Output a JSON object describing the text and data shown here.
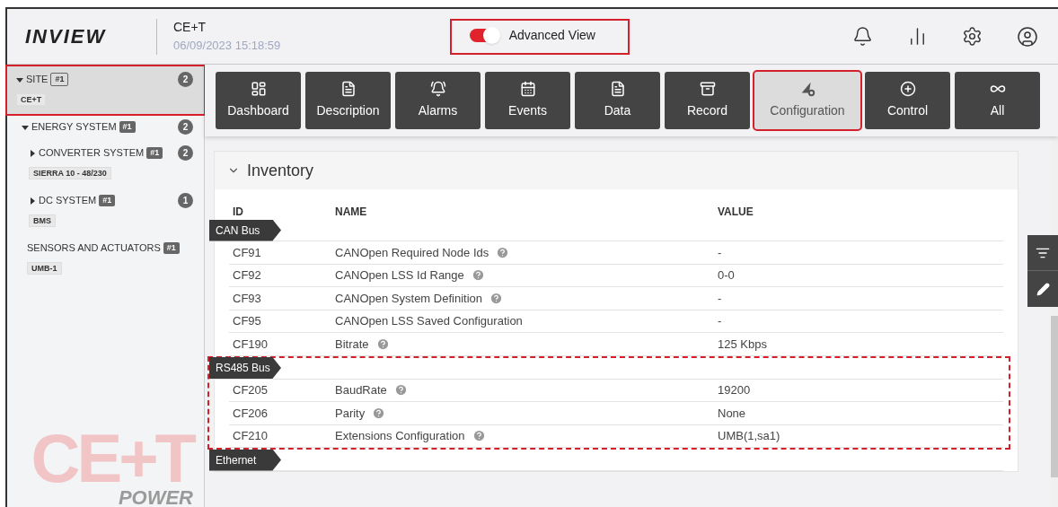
{
  "header": {
    "logo": "INVIEW",
    "site": "CE+T",
    "datetime": "06/09/2023 15:18:59",
    "advanced_view": {
      "label": "Advanced View",
      "on": true,
      "highlighted": true
    }
  },
  "sidebar": {
    "items": [
      {
        "label": "SITE",
        "tag": "#1",
        "sub": "CE+T",
        "count": "2",
        "expanded": true,
        "selected": true,
        "highlighted": true,
        "children": [
          {
            "label": "ENERGY SYSTEM",
            "tag": "#1",
            "count": "2",
            "expanded": true,
            "selected": false,
            "highlighted": false,
            "children": [
              {
                "label": "CONVERTER SYSTEM",
                "tag": "#1",
                "sub": "SIERRA 10 - 48/230",
                "count": "2",
                "expanded": false,
                "selected": false,
                "highlighted": false
              },
              {
                "label": "DC SYSTEM",
                "tag": "#1",
                "sub": "BMS",
                "count": "1",
                "expanded": false,
                "selected": false,
                "highlighted": false
              }
            ]
          },
          {
            "label": "SENSORS AND ACTUATORS",
            "tag": "#1",
            "sub": "UMB-1",
            "selected": false,
            "highlighted": false
          }
        ]
      }
    ],
    "logo": {
      "mark": "CE+T",
      "word": "POWER"
    }
  },
  "tabs": [
    {
      "label": "Dashboard",
      "selected": false,
      "highlighted": false
    },
    {
      "label": "Description",
      "selected": false,
      "highlighted": false
    },
    {
      "label": "Alarms",
      "selected": false,
      "highlighted": false
    },
    {
      "label": "Events",
      "selected": false,
      "highlighted": false
    },
    {
      "label": "Data",
      "selected": false,
      "highlighted": false
    },
    {
      "label": "Record",
      "selected": false,
      "highlighted": false
    },
    {
      "label": "Configuration",
      "selected": true,
      "highlighted": true
    },
    {
      "label": "Control",
      "selected": false,
      "highlighted": false
    },
    {
      "label": "All",
      "selected": false,
      "highlighted": false
    }
  ],
  "panel": {
    "title": "Inventory",
    "expanded": true,
    "columns": [
      "ID",
      "NAME",
      "VALUE"
    ],
    "groups": [
      {
        "label": "CAN Bus",
        "highlighted": false,
        "rows": [
          {
            "id": "CF91",
            "name": "CANOpen Required Node Ids",
            "help": true,
            "value": "-"
          },
          {
            "id": "CF92",
            "name": "CANOpen LSS Id Range",
            "help": true,
            "value": "0-0"
          },
          {
            "id": "CF93",
            "name": "CANOpen System Definition",
            "help": true,
            "value": "-"
          },
          {
            "id": "CF95",
            "name": "CANOpen LSS Saved Configuration",
            "help": false,
            "value": "-"
          },
          {
            "id": "CF190",
            "name": "Bitrate",
            "help": true,
            "value": "125 Kbps"
          }
        ]
      },
      {
        "label": "RS485 Bus",
        "highlighted": true,
        "rows": [
          {
            "id": "CF205",
            "name": "BaudRate",
            "help": true,
            "value": "19200"
          },
          {
            "id": "CF206",
            "name": "Parity",
            "help": true,
            "value": "None"
          },
          {
            "id": "CF210",
            "name": "Extensions Configuration",
            "help": true,
            "value": "UMB(1,sa1)"
          }
        ]
      },
      {
        "label": "Ethernet",
        "highlighted": false
      }
    ]
  }
}
